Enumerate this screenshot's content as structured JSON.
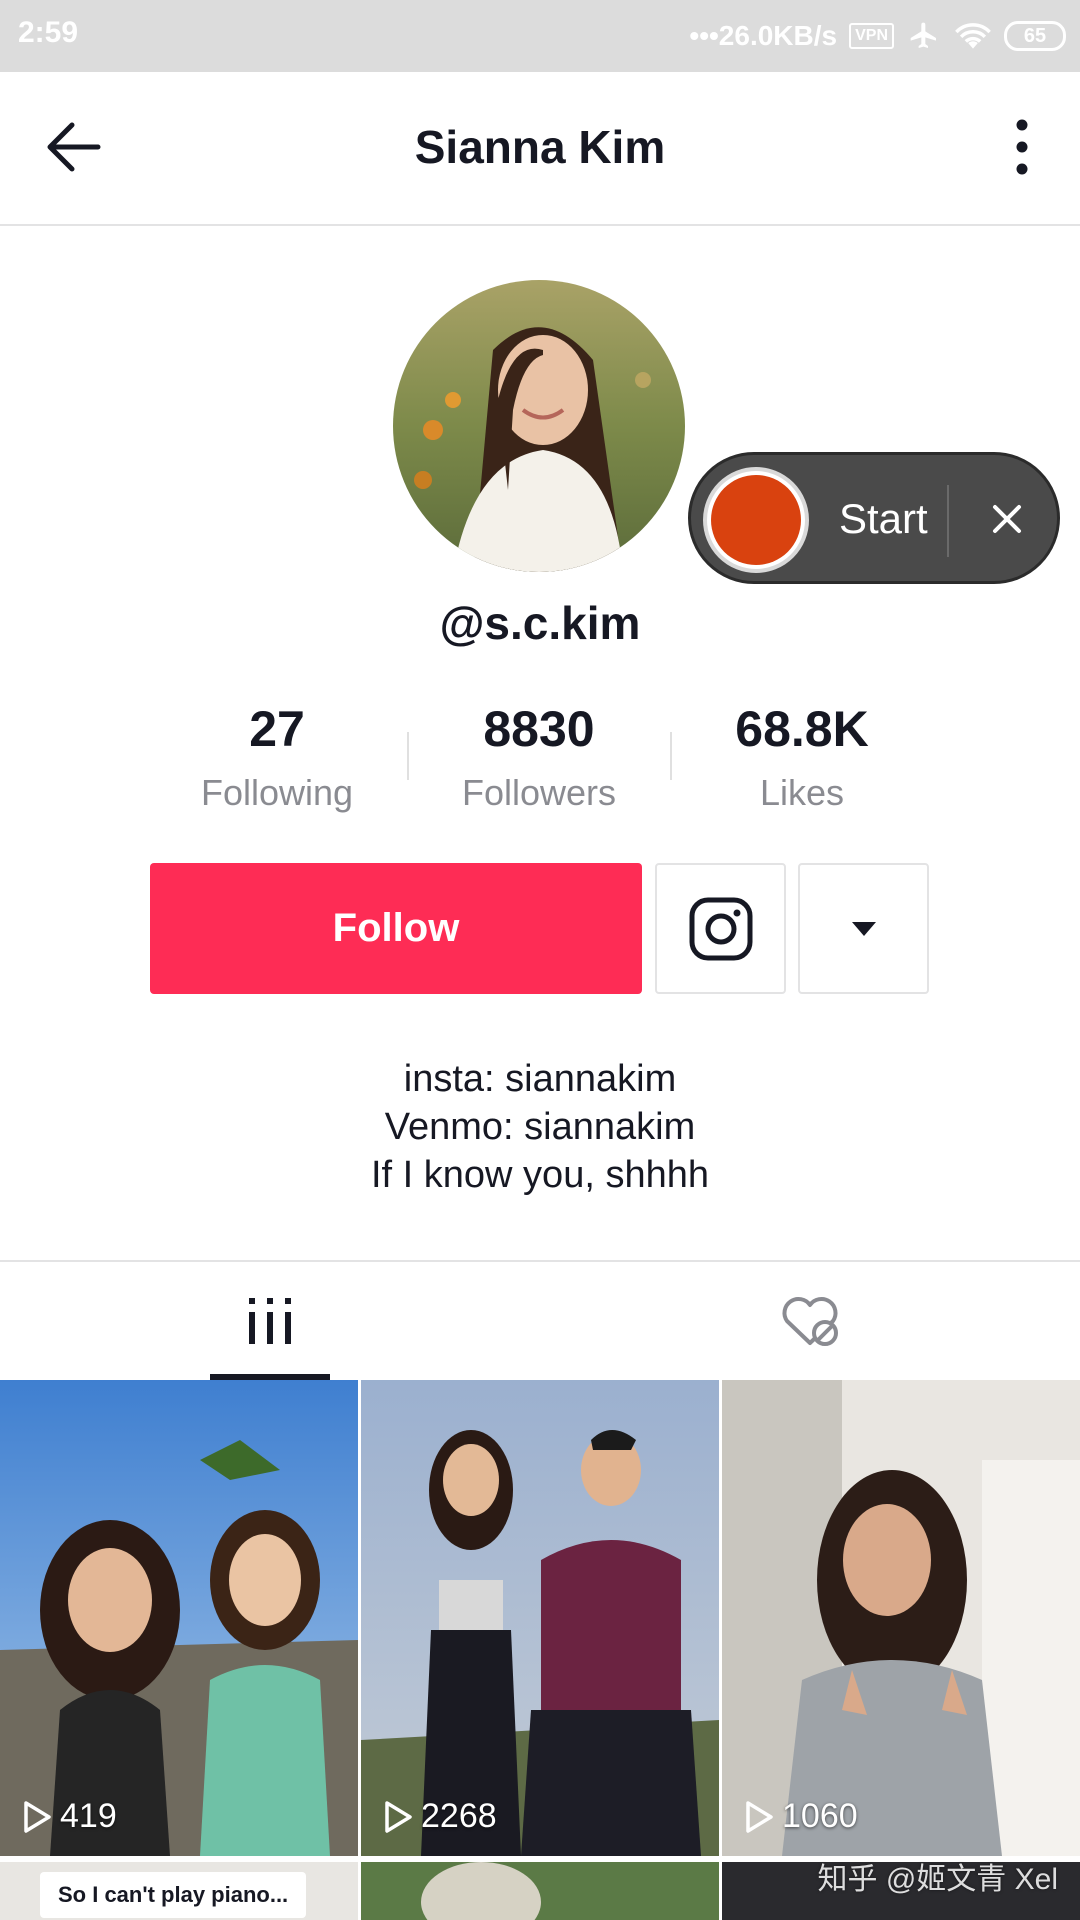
{
  "status_bar": {
    "time": "2:59",
    "network_speed": "•••26.0KB/s",
    "vpn": "VPN",
    "battery": "65",
    "icons": [
      "airplane-icon",
      "wifi-icon"
    ]
  },
  "header": {
    "title": "Sianna Kim",
    "back_icon": "arrow-left-icon",
    "more_icon": "vertical-dots-icon"
  },
  "profile": {
    "username": "@s.c.kim",
    "stats": [
      {
        "value": "27",
        "label": "Following"
      },
      {
        "value": "8830",
        "label": "Followers"
      },
      {
        "value": "68.8K",
        "label": "Likes"
      }
    ],
    "follow_label": "Follow",
    "bio": [
      "insta: siannakim",
      "Venmo: siannakim",
      "If I know you, shhhh"
    ]
  },
  "recorder": {
    "start_label": "Start"
  },
  "tabs": [
    {
      "icon": "grid-icon",
      "active": true
    },
    {
      "icon": "liked-private-icon",
      "active": false
    }
  ],
  "videos": [
    {
      "plays": "419"
    },
    {
      "plays": "2268"
    },
    {
      "plays": "1060"
    }
  ],
  "partial_caption": "So I can't play piano...",
  "watermark": "知乎 @姬文青 Xel",
  "colors": {
    "accent": "#fe2c55",
    "recorder_dot": "#d9420f",
    "muted_text": "#8a8b91"
  }
}
